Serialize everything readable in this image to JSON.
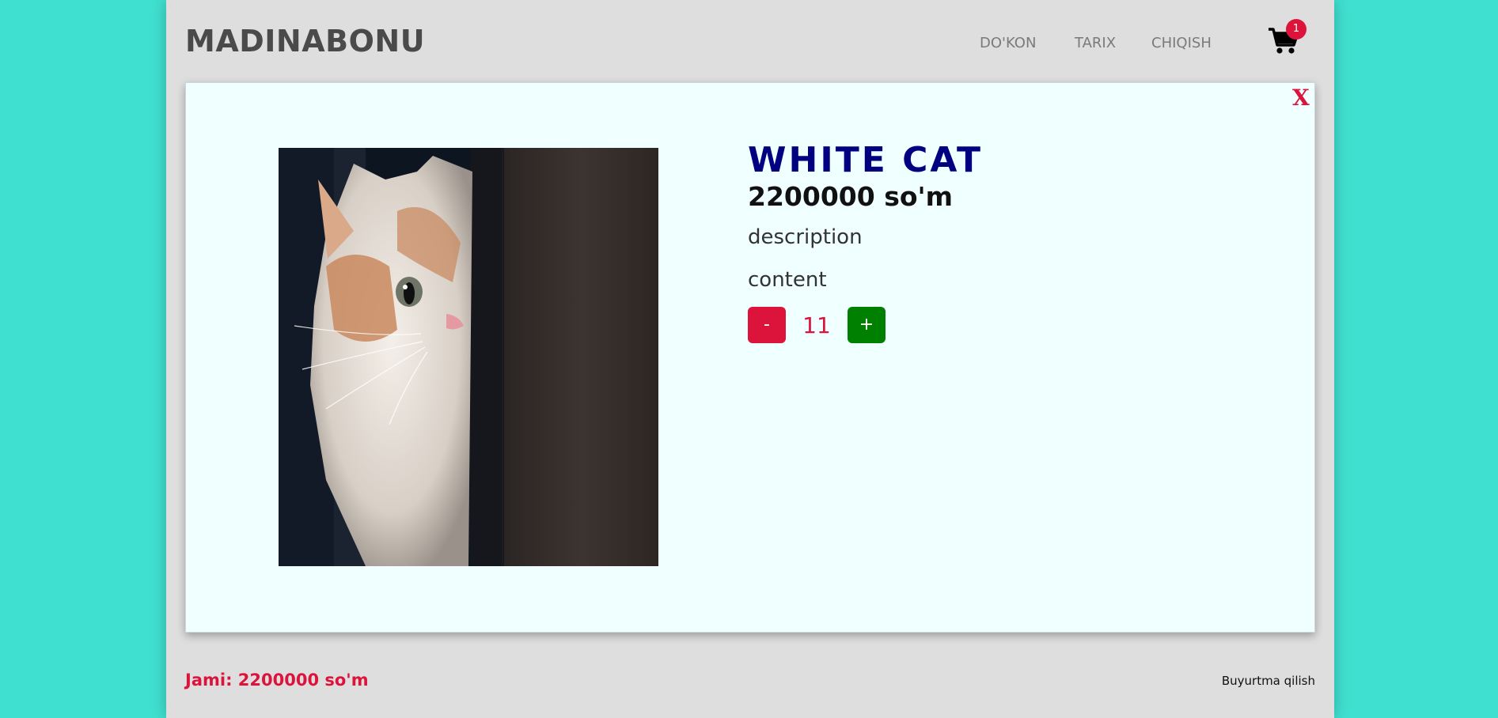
{
  "header": {
    "brand": "MADINABONU",
    "nav": [
      {
        "label": "DO'KON"
      },
      {
        "label": "TARIX"
      },
      {
        "label": "CHIQISH"
      }
    ],
    "cart": {
      "icon": "cart-icon",
      "count": "1"
    }
  },
  "modal": {
    "close_label": "X",
    "product": {
      "image": "white-cat-photo",
      "title": "WHITE CAT",
      "price": "2200000 so'm",
      "description": "description",
      "content": "content",
      "quantity": "11",
      "minus_label": "-",
      "plus_label": "+"
    }
  },
  "footer": {
    "total": "Jami: 2200000 so'm",
    "order_label": "Buyurtma qilish"
  },
  "colors": {
    "background": "#40E0D0",
    "page": "#DEDEDE",
    "modal": "#F0FFFF",
    "accent": "#DC143C",
    "title": "#000080",
    "plus": "#008000"
  }
}
